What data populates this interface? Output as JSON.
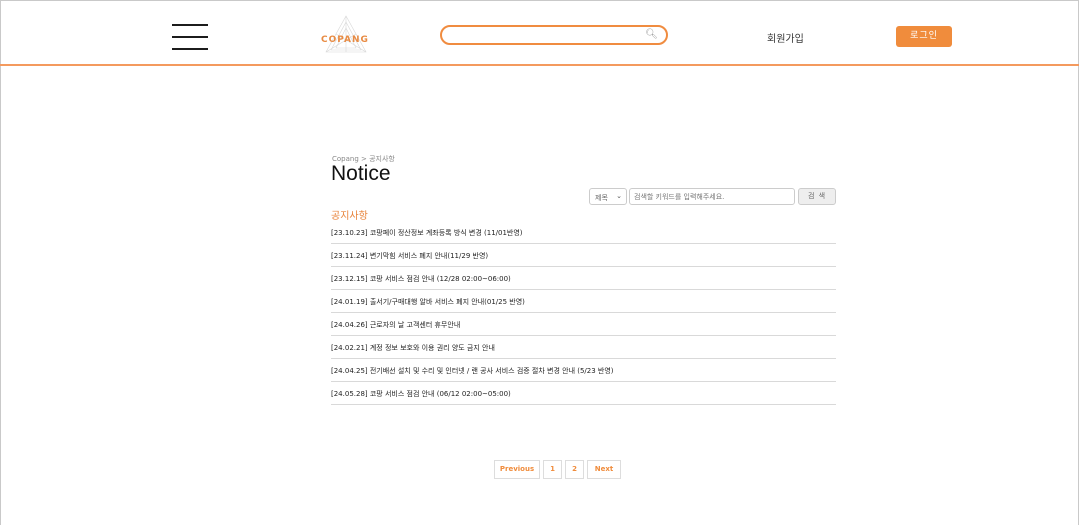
{
  "header": {
    "logo_text": "COPANG",
    "search_placeholder": "",
    "signup_label": "회원가입",
    "login_label": "로그인"
  },
  "breadcrumb": "Copang > 공지사항",
  "title": "Notice",
  "filter": {
    "select_value": "제목",
    "keyword_placeholder": "검색할 키워드를 입력해주세요.",
    "search_button": "검 색"
  },
  "section_title": "공지사항",
  "notices": [
    "[23.10.23] 코팡페이 정산정보 계좌등록 방식 변경 (11/01반영)",
    "[23.11.24] 변기막힘 서비스 폐지 안내(11/29 반영)",
    "[23.12.15] 코팡 서비스 점검 안내 (12/28 02:00~06:00)",
    "[24.01.19] 출서기/구매대행 알바 서비스 폐지 안내(01/25 반영)",
    "[24.04.26] 근로자의 날 고객센터 휴무안내",
    "[24.02.21] 계정 정보 보호와 이용 권리 양도 금지 안내",
    "[24.04.25] 전기배선 설치 및 수리 및 인터넷 / 랜 공사 서비스 검증 절차 변경 안내 (5/23 반영)",
    "[24.05.28] 코팡 서비스 점검 안내 (06/12 02:00~05:00)"
  ],
  "pagination": {
    "previous": "Previous",
    "pages": [
      "1",
      "2"
    ],
    "next": "Next"
  },
  "colors": {
    "accent": "#f08c3c",
    "header_border": "#f49a5e"
  }
}
